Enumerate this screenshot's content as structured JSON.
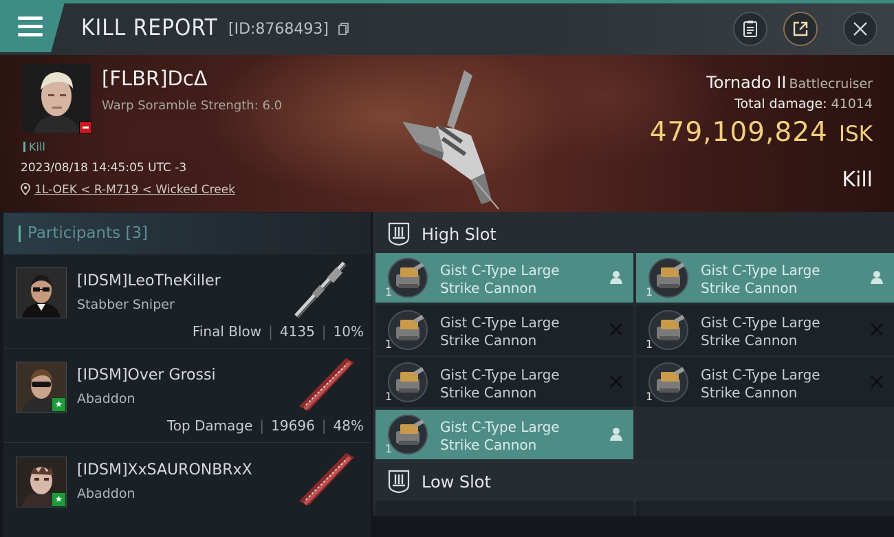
{
  "header": {
    "title": "KILL REPORT",
    "report_id": "[ID:8768493]",
    "icons": [
      "menu-icon",
      "copy-icon",
      "clipboard-icon",
      "share-icon",
      "close-icon"
    ]
  },
  "victim": {
    "name": "[FLBR]DcΔ",
    "warp_scramble": "Warp Soramble Strength: 6.0",
    "tag": "Kill",
    "datetime": "2023/08/18 14:45:05 UTC -3",
    "location": "1L-OEK < R-M719 < Wicked Creek",
    "ship_name": "Tornado II",
    "ship_class": "Battlecruiser",
    "total_damage_label": "Total damage:",
    "total_damage": "41014",
    "isk_value": "479,109,824",
    "isk_unit": "ISK",
    "result": "Kill"
  },
  "participants": {
    "heading": "Participants",
    "count": "[3]",
    "rows": [
      {
        "name": "[IDSM]LeoTheKiller",
        "ship": "Stabber Sniper",
        "label": "Final Blow",
        "damage": "4135",
        "percent": "10%",
        "sep": "|"
      },
      {
        "name": "[IDSM]Over Grossi",
        "ship": "Abaddon",
        "label": "Top Damage",
        "damage": "19696",
        "percent": "48%",
        "sep": "|"
      },
      {
        "name": "[IDSM]XxSAURONBRxX",
        "ship": "Abaddon",
        "label": "",
        "damage": "",
        "percent": "",
        "sep": ""
      }
    ]
  },
  "slots": {
    "high": {
      "label": "High Slot",
      "modules": [
        {
          "name1": "Gist C-Type Large",
          "name2": "Strike Cannon",
          "qty": "1",
          "state": "fitted"
        },
        {
          "name1": "Gist C-Type Large",
          "name2": "Strike Cannon",
          "qty": "1",
          "state": "fitted"
        },
        {
          "name1": "Gist C-Type Large",
          "name2": "Strike Cannon",
          "qty": "1",
          "state": "destroyed"
        },
        {
          "name1": "Gist C-Type Large",
          "name2": "Strike Cannon",
          "qty": "1",
          "state": "destroyed"
        },
        {
          "name1": "Gist C-Type Large",
          "name2": "Strike Cannon",
          "qty": "1",
          "state": "destroyed"
        },
        {
          "name1": "Gist C-Type Large",
          "name2": "Strike Cannon",
          "qty": "1",
          "state": "destroyed"
        },
        {
          "name1": "Gist C-Type Large",
          "name2": "Strike Cannon",
          "qty": "1",
          "state": "fitted"
        }
      ]
    },
    "low": {
      "label": "Low Slot"
    }
  },
  "colors": {
    "accent": "#4e8d86",
    "isk": "#f4cf7b",
    "background": "#14181d"
  }
}
